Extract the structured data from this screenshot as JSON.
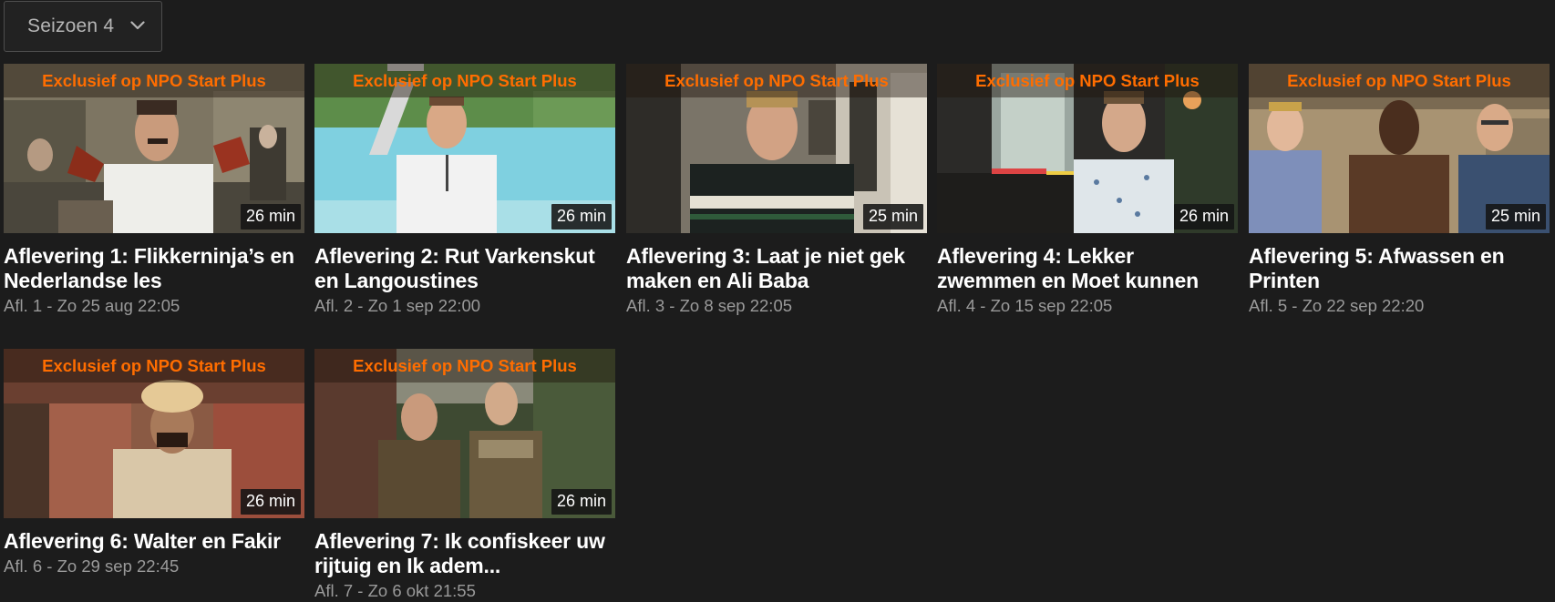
{
  "season_selector": {
    "label": "Seizoen 4",
    "icon": "chevron-down-icon"
  },
  "episodes": [
    {
      "badge": "Exclusief op NPO Start Plus",
      "duration": "26 min",
      "title": "Aflevering 1: Flikkerninja’s en Nederlandse les",
      "meta": "Afl. 1 - Zo 25 aug 22:05"
    },
    {
      "badge": "Exclusief op NPO Start Plus",
      "duration": "26 min",
      "title": "Aflevering 2: Rut Varkenskut en Langoustines",
      "meta": "Afl. 2 - Zo 1 sep 22:00"
    },
    {
      "badge": "Exclusief op NPO Start Plus",
      "duration": "25 min",
      "title": "Aflevering 3: Laat je niet gek maken en Ali Baba",
      "meta": "Afl. 3 - Zo 8 sep 22:05"
    },
    {
      "badge": "Exclusief op NPO Start Plus",
      "duration": "26 min",
      "title": "Aflevering 4: Lekker zwemmen en Moet kunnen",
      "meta": "Afl. 4 - Zo 15 sep 22:05"
    },
    {
      "badge": "Exclusief op NPO Start Plus",
      "duration": "25 min",
      "title": "Aflevering 5: Afwassen en Printen",
      "meta": "Afl. 5 - Zo 22 sep 22:20"
    },
    {
      "badge": "Exclusief op NPO Start Plus",
      "duration": "26 min",
      "title": "Aflevering 6: Walter en Fakir",
      "meta": "Afl. 6 - Zo 29 sep 22:45"
    },
    {
      "badge": "Exclusief op NPO Start Plus",
      "duration": "26 min",
      "title": "Aflevering 7: Ik confiskeer uw rijtuig en Ik adem...",
      "meta": "Afl. 7 - Zo 6 okt 21:55"
    }
  ],
  "colors": {
    "background": "#1c1c1c",
    "badge_text": "#ff6d00",
    "meta_text": "#9a9a9a"
  }
}
